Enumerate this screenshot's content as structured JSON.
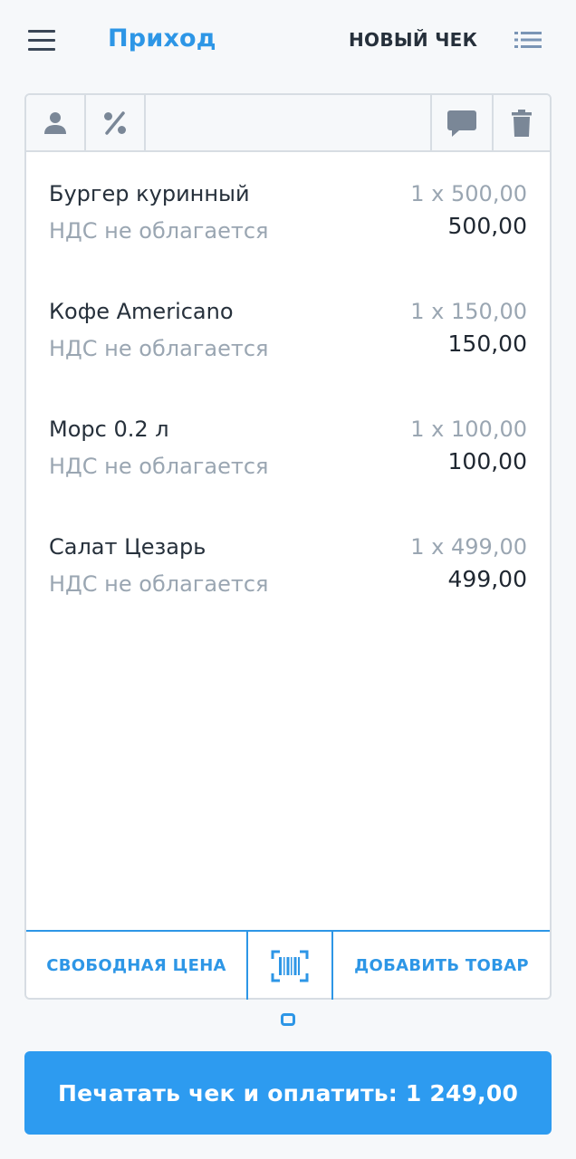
{
  "header": {
    "title": "Приход",
    "new_check_label": "НОВЫЙ ЧЕК",
    "menu_icon": "hamburger-menu-icon",
    "list_icon": "list-icon"
  },
  "toolbar": {
    "icons": [
      "person-icon",
      "percent-icon",
      "comment-icon",
      "trash-icon"
    ]
  },
  "items": [
    {
      "name": "Бургер куринный",
      "vat": "НДС не облагается",
      "qty_price": "1 x 500,00",
      "sum": "500,00"
    },
    {
      "name": "Кофе Americano",
      "vat": "НДС не облагается",
      "qty_price": "1 x 150,00",
      "sum": "150,00"
    },
    {
      "name": "Морс 0.2 л",
      "vat": "НДС не облагается",
      "qty_price": "1 x 100,00",
      "sum": "100,00"
    },
    {
      "name": "Салат Цезарь",
      "vat": "НДС не облагается",
      "qty_price": "1 x 499,00",
      "sum": "499,00"
    }
  ],
  "bottom_bar": {
    "free_price_label": "СВОБОДНАЯ ЦЕНА",
    "barcode_icon": "barcode-scan-icon",
    "add_item_label": "ДОБАВИТЬ ТОВАР"
  },
  "pay_button": {
    "label": "Печатать чек и оплатить: 1 249,00"
  },
  "colors": {
    "accent": "#2d96e6",
    "pay_button": "#2d9bf0",
    "text": "#26303b",
    "muted": "#9aa6b2",
    "background": "#f6f8fa"
  }
}
